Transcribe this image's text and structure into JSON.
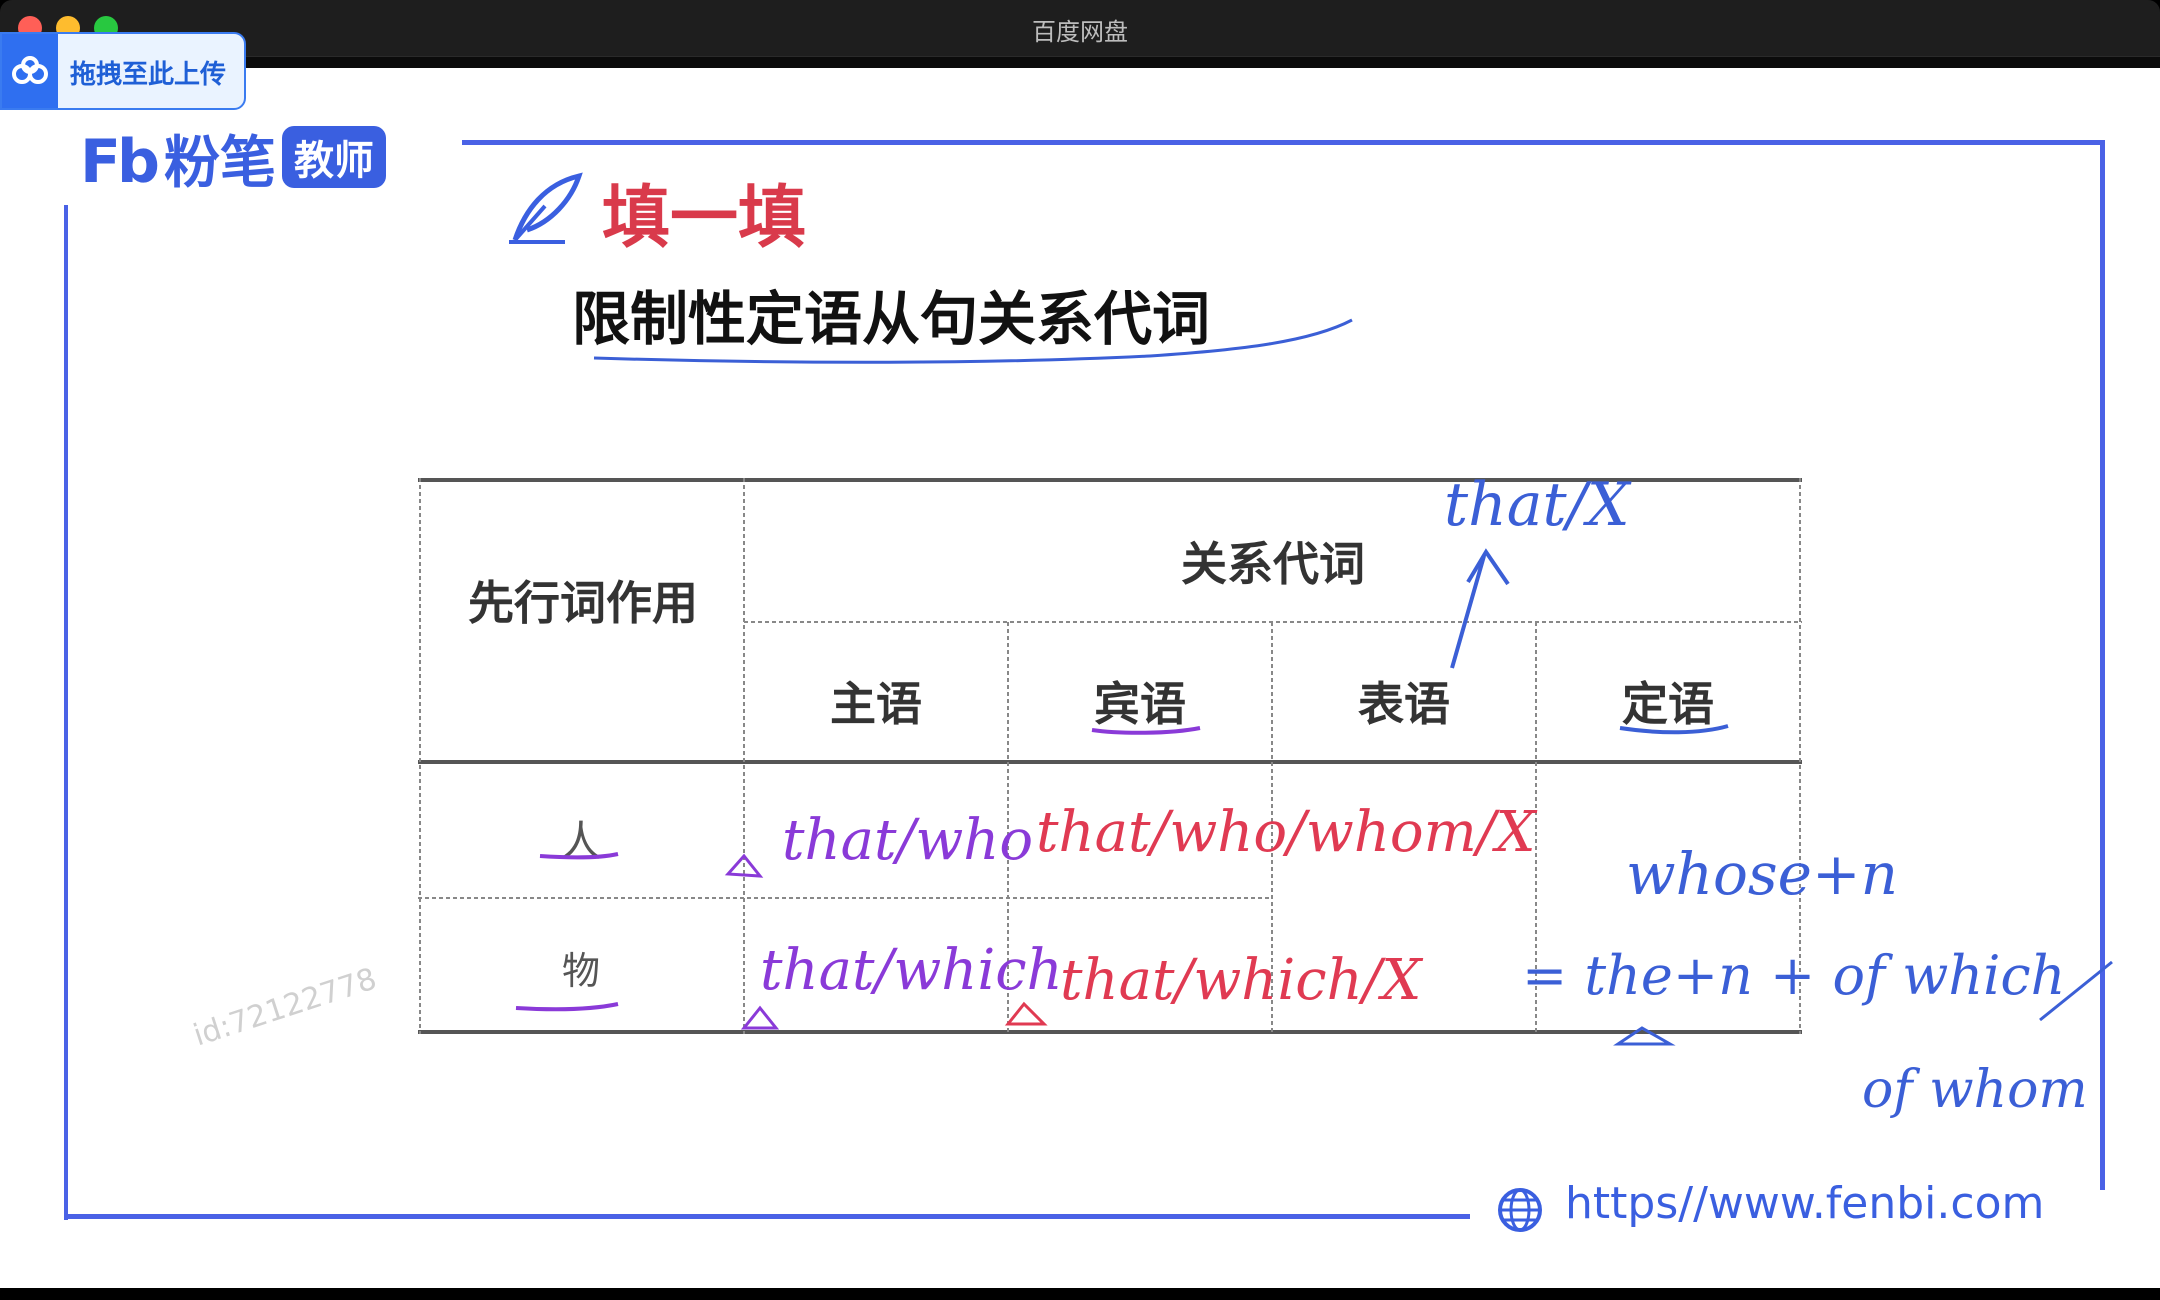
{
  "window": {
    "title": "百度网盘"
  },
  "upload": {
    "label": "拖拽至此上传"
  },
  "logo": {
    "fb": "Fb",
    "brand": "粉笔",
    "badge": "教师"
  },
  "slide": {
    "section_title": "填一填",
    "subtitle": "限制性定语从句关系代词",
    "table": {
      "header_left": "先行词作用",
      "header_top": "关系代词",
      "columns": [
        "主语",
        "宾语",
        "表语",
        "定语"
      ],
      "rows": [
        "人",
        "物"
      ]
    },
    "watermark": "id:72122778",
    "url": "https//www.fenbi.com"
  },
  "annotations": {
    "above_biaoyu": "that/X",
    "person_subject": "that/who",
    "person_object": "that/who/whom/X",
    "thing_subject": "that/which",
    "thing_object": "that/which/X",
    "attr_line1": "whose+n",
    "attr_line2": "= the+n + of which",
    "attr_line3": "of whom"
  },
  "colors": {
    "frame": "#4a62e6",
    "brand": "#3a5fe0",
    "title_red": "#d93a4b",
    "ink_red": "#e03a52",
    "ink_purple": "#8a3ad8",
    "ink_blue": "#3b5fd6"
  }
}
